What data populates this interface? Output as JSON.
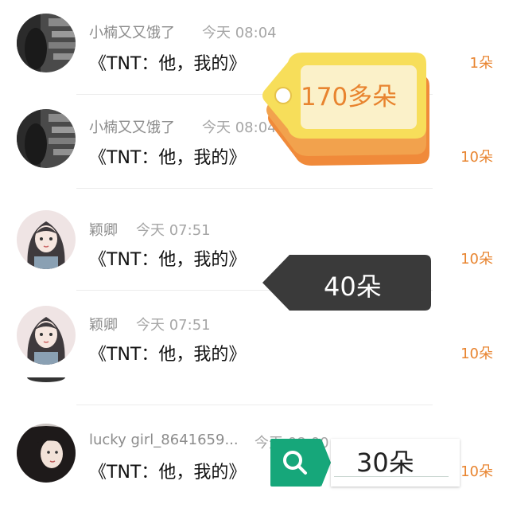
{
  "rows": [
    {
      "name": "小楠又又饿了",
      "time": "今天 08:04",
      "message": "《TNT：他，我的》",
      "count": "1朵"
    },
    {
      "name": "小楠又又饿了",
      "time": "今天 08:04",
      "message": "《TNT：他，我的》",
      "count": "10朵"
    },
    {
      "name": "颖卿",
      "time": "今天 07:51",
      "message": "《TNT：他，我的》",
      "count": "10朵"
    },
    {
      "name": "颖卿",
      "time": "今天 07:51",
      "message": "《TNT：他，我的》",
      "count": "10朵"
    },
    {
      "name": "lucky girl_8641659...",
      "time": "今天 08:00",
      "message": "《TNT：他，我的》",
      "count": "10朵"
    }
  ],
  "overlays": {
    "price_tag": "170多朵",
    "dark_tag": "40朵",
    "search_tag": "30朵"
  },
  "colors": {
    "accent_orange": "#e8842f",
    "tag_yellow": "#f7de5a",
    "tag_orange": "#f08a3a",
    "dark_tag": "#3a3a3a",
    "search_green": "#16a77a"
  }
}
